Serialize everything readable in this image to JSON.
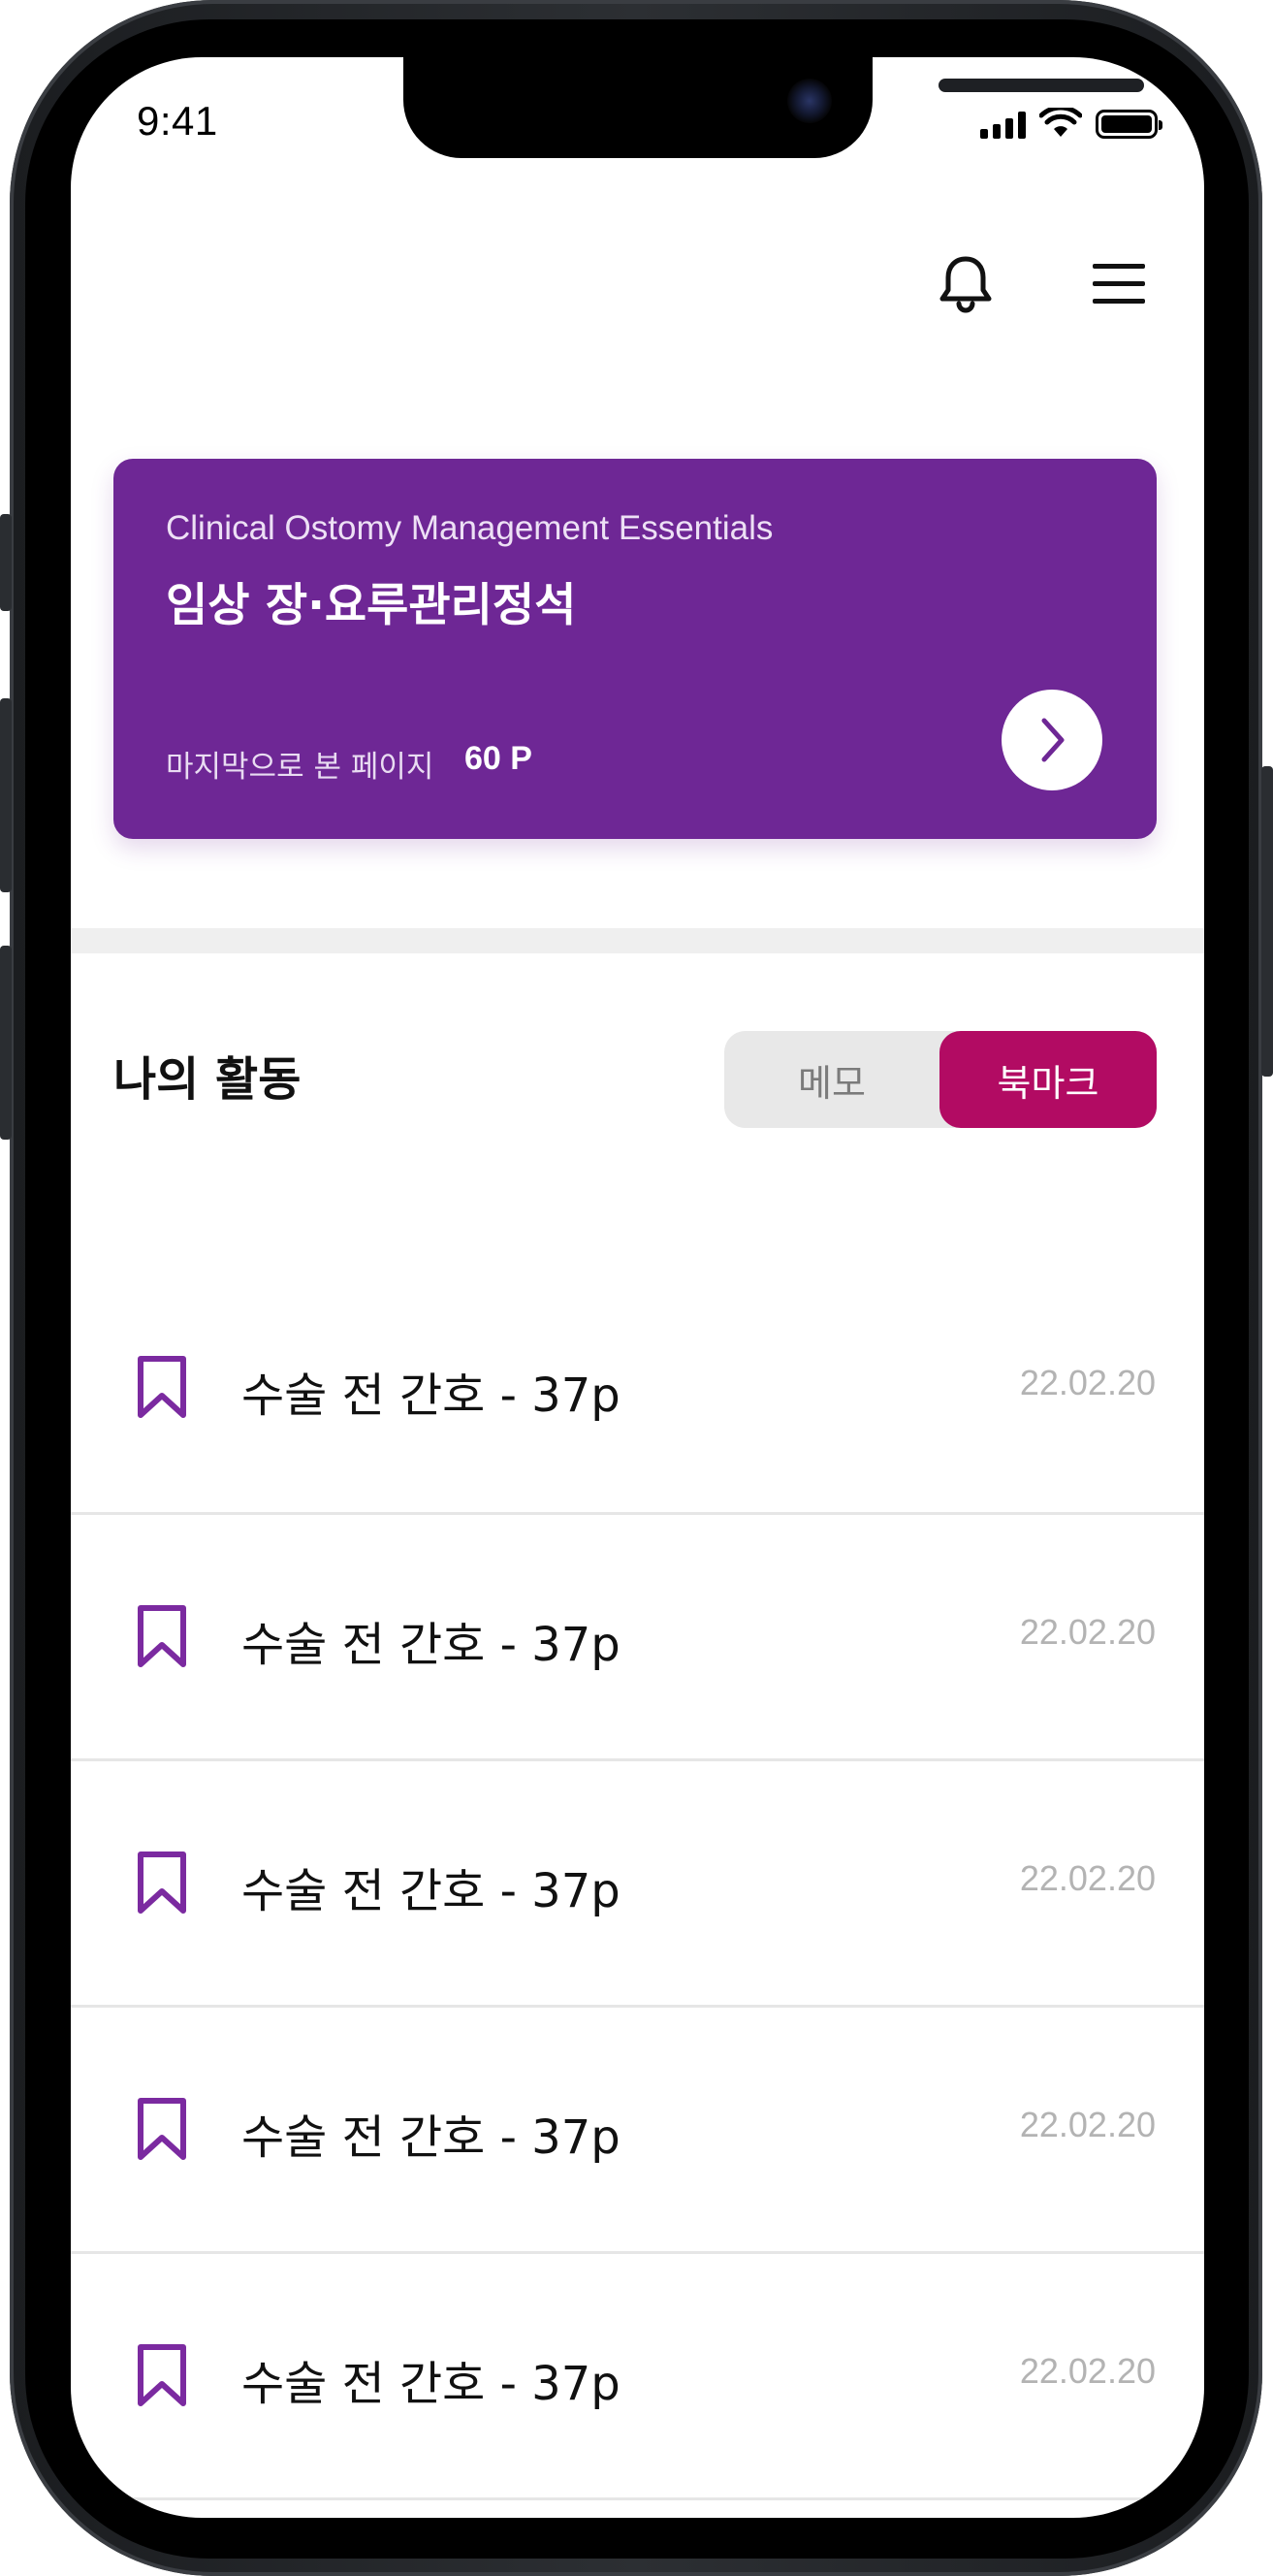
{
  "status_bar": {
    "time": "9:41",
    "icons": [
      "signal-icon",
      "wifi-icon",
      "battery-icon"
    ]
  },
  "header": {
    "icons": [
      "bell-icon",
      "menu-icon"
    ]
  },
  "book_card": {
    "title_en": "Clinical Ostomy Management Essentials",
    "title_ko": "임상 장·요루관리정석",
    "last_page_label": "마지막으로 본 페이지",
    "last_page_value": "60 P",
    "background_color": "#6e2795",
    "action_icon": "chevron-right-icon"
  },
  "activity": {
    "title": "나의 활동",
    "tabs": [
      {
        "label": "메모",
        "selected": false
      },
      {
        "label": "북마크",
        "selected": true
      }
    ],
    "accent_color": "#b20b63"
  },
  "bookmarks": {
    "icon": "bookmark-icon",
    "icon_color": "#7b2aa0",
    "items": [
      {
        "title": "수술 전 간호 - 37p",
        "date": "22.02.20"
      },
      {
        "title": "수술 전 간호 - 37p",
        "date": "22.02.20"
      },
      {
        "title": "수술 전 간호 - 37p",
        "date": "22.02.20"
      },
      {
        "title": "수술 전 간호 - 37p",
        "date": "22.02.20"
      },
      {
        "title": "수술 전 간호 - 37p",
        "date": "22.02.20"
      }
    ]
  }
}
